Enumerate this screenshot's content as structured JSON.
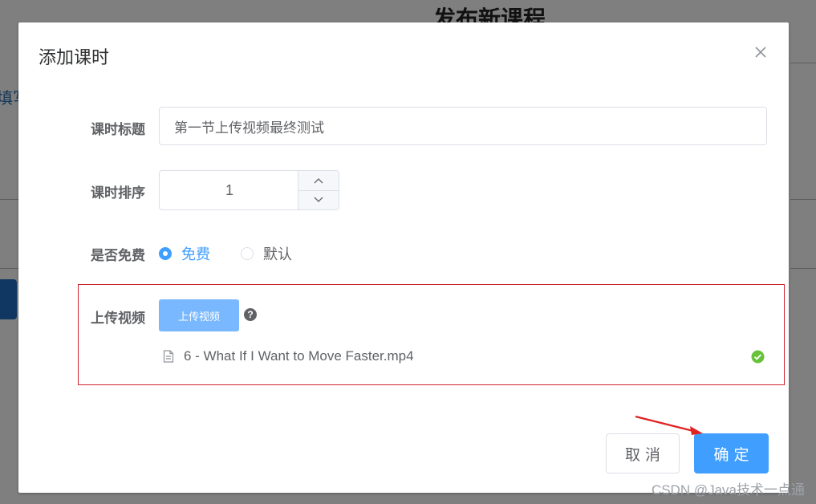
{
  "background": {
    "page_title": "发布新课程",
    "left_text": "填写"
  },
  "dialog": {
    "title": "添加课时",
    "form": {
      "title_label": "课时标题",
      "title_value": "第一节上传视频最终测试",
      "sort_label": "课时排序",
      "sort_value": "1",
      "free_label": "是否免费",
      "radio_options": [
        "免费",
        "默认"
      ],
      "radio_selected": "免费",
      "upload_label": "上传视频",
      "upload_button": "上传视频",
      "help_glyph": "?",
      "uploaded_file": "6 - What If I Want to Move Faster.mp4",
      "upload_status": "success"
    },
    "buttons": {
      "cancel": "取消",
      "confirm": "确定"
    }
  },
  "watermark": "CSDN @Java技术一点通",
  "colors": {
    "primary": "#409eff",
    "primary_light": "#79b8ff",
    "success": "#67c23a",
    "annotation_red": "#d0232b",
    "text": "#606266"
  }
}
